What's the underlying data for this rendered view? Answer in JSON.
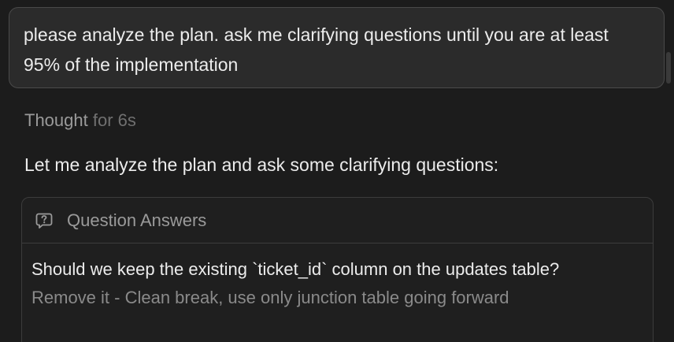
{
  "user_message": {
    "text": "please analyze the plan. ask me clarifying questions until you are at least 95% of the implementation"
  },
  "thought": {
    "label": "Thought",
    "duration": "for 6s"
  },
  "assistant": {
    "text": "Let me analyze the plan and ask some clarifying questions:"
  },
  "qa_card": {
    "icon": "question-bubble-icon",
    "title": "Question Answers",
    "question": "Should we keep the existing `ticket_id` column on the updates table?",
    "answer": "Remove it - Clean break, use only junction table going forward"
  }
}
